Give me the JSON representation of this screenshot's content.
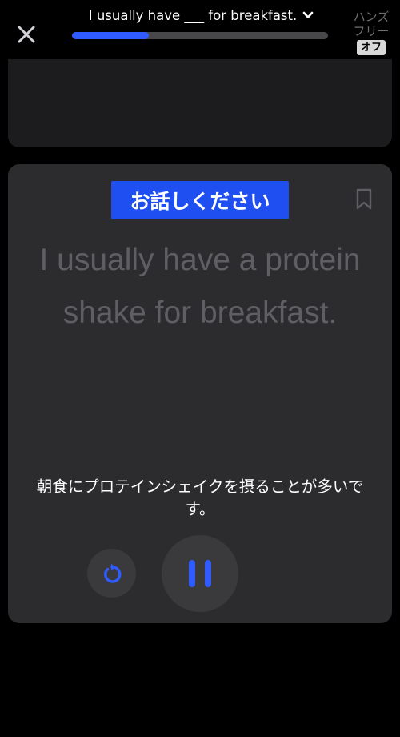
{
  "header": {
    "close_icon": "close-icon",
    "lesson_title": "I usually have ___ for breakfast.",
    "dropdown_icon": "chevron-down-icon",
    "progress_fraction": 0.3,
    "handsfree": {
      "label": "ハンズフリー",
      "state": "オフ"
    }
  },
  "card": {
    "prompt_badge": "お話しください",
    "bookmark_icon": "bookmark-icon",
    "sentence": "I usually have a protein shake for breakfast.",
    "translation": "朝食にプロテインシェイクを摂ることが多いです。",
    "replay_icon": "replay-icon",
    "pause_icon": "pause-icon"
  },
  "colors": {
    "accent": "#1f4ff0",
    "progress": "#2f5bff",
    "card_background": "#2c2c2e",
    "sentence_text": "#5f5f63"
  }
}
